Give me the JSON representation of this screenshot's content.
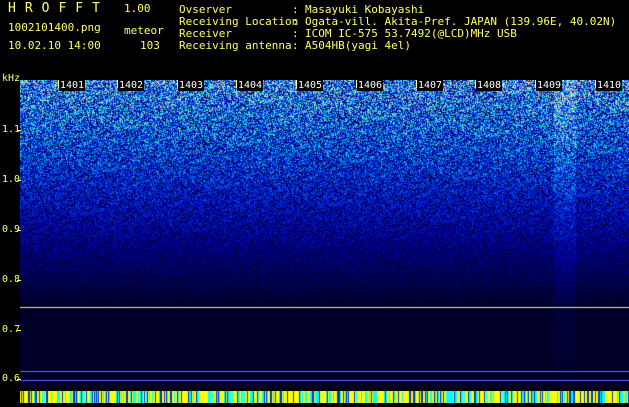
{
  "header": {
    "app_title": "HROFFT",
    "version": "1.00",
    "filename": "1002101400.png",
    "mode": "meteor",
    "datetime": "10.02.10 14:00",
    "count": "103",
    "info": [
      {
        "key": "Ovserver",
        "value": "Masayuki Kobayashi"
      },
      {
        "key": "Receiving Location",
        "value": "Ogata-vill. Akita-Pref. JAPAN (139.96E, 40.02N)"
      },
      {
        "key": "Receiver",
        "value": "ICOM IC-575 53.7492(@LCD)MHz USB"
      },
      {
        "key": "Receiving antenna",
        "value": "A504HB(yagi 4el)"
      }
    ],
    "separator": ":"
  },
  "axis": {
    "unit": "kHz",
    "y_ticks": [
      "1.1",
      "1.0",
      "0.9",
      "0.8",
      "0.7",
      "0.6"
    ],
    "x_ticks": [
      "1401",
      "1402",
      "1403",
      "1404",
      "1405",
      "1406",
      "1407",
      "1408",
      "1409",
      "1410"
    ]
  },
  "colors": {
    "background": "#000000",
    "label": "#ffff66",
    "tick_text": "#ffffff",
    "carrier_line": "#e0ff40",
    "bottom_bar": "#ffff00"
  }
}
